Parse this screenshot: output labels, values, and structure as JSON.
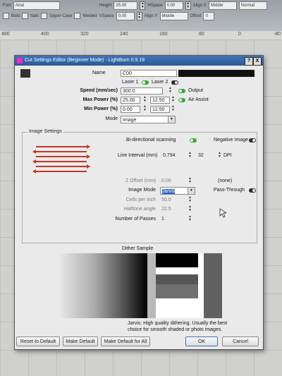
{
  "toolbar": {
    "font_label": "Font",
    "font_value": "Arial",
    "bold_label": "Bold",
    "italic_label": "Italic",
    "upper_label": "Upper Case",
    "welded_label": "Welded",
    "height_label": "Height",
    "height_value": "25.00",
    "hspace_label": "HSpace",
    "hspace_value": "0.00",
    "vspace_label": "VSpace",
    "vspace_value": "0.00",
    "alignx_label": "Align X",
    "alignx_value": "Middle",
    "aligny_label": "Align Y",
    "aligny_value": "Middle",
    "normal_value": "Normal",
    "offset_label": "Offset",
    "offset_value": "0"
  },
  "ruler": {
    "ticks": [
      "480",
      "400",
      "320",
      "240",
      "160",
      "80",
      "0",
      "-80"
    ]
  },
  "dialog": {
    "title": "Cut Settings Editor (Beginner Mode) - LightBurn 0.9.19",
    "help_button": "?",
    "close_button": "X",
    "name_label": "Name",
    "name_value": "C00",
    "laser1_label": "Laser 1",
    "laser2_label": "Laser 2",
    "speed_label": "Speed (mm/sec)",
    "speed_value": "300.0",
    "output_label": "Output",
    "maxpower_label": "Max Power (%)",
    "maxpower_value1": "25.00",
    "maxpower_value2": "12.50",
    "airassist_label": "Air Assist",
    "minpower_label": "Min Power (%)",
    "minpower_value1": "0.00",
    "minpower_value2": "12.50",
    "mode_label": "Mode",
    "mode_value": "Image",
    "image_settings_title": "Image Settings",
    "bidir_label": "Bi-directional scanning",
    "negative_label": "Negative Image",
    "line_interval_label": "Line Interval (mm)",
    "line_interval_value": "0.794",
    "dpi_value": "32",
    "dpi_label": "DPI",
    "zoffset_label": "Z Offset (mm)",
    "zoffset_value": "0.00",
    "none_label": "(none)",
    "image_mode_label": "Image Mode",
    "image_mode_value": "Jarvis",
    "passthrough_label": "Pass-Through",
    "cells_label": "Cells per inch",
    "cells_value": "50.0",
    "halftone_label": "Halftone angle",
    "halftone_value": "22.5",
    "passes_label": "Number of Passes",
    "passes_value": "1",
    "dither_title": "Dither Sample",
    "dither_desc_1": "Jarvis: High quality dithering. Usually the best",
    "dither_desc_2": "choice for smooth shaded or photo images.",
    "reset_button": "Reset to Default",
    "make_default_button": "Make Default",
    "make_default_all_button": "Make Default for All",
    "ok_button": "OK",
    "cancel_button": "Cancel"
  },
  "colors": {
    "title_bar": "#2a5a98",
    "toggle_on": "#33aa33",
    "line_color": "#c0392b",
    "selection": "#2d63c8"
  }
}
